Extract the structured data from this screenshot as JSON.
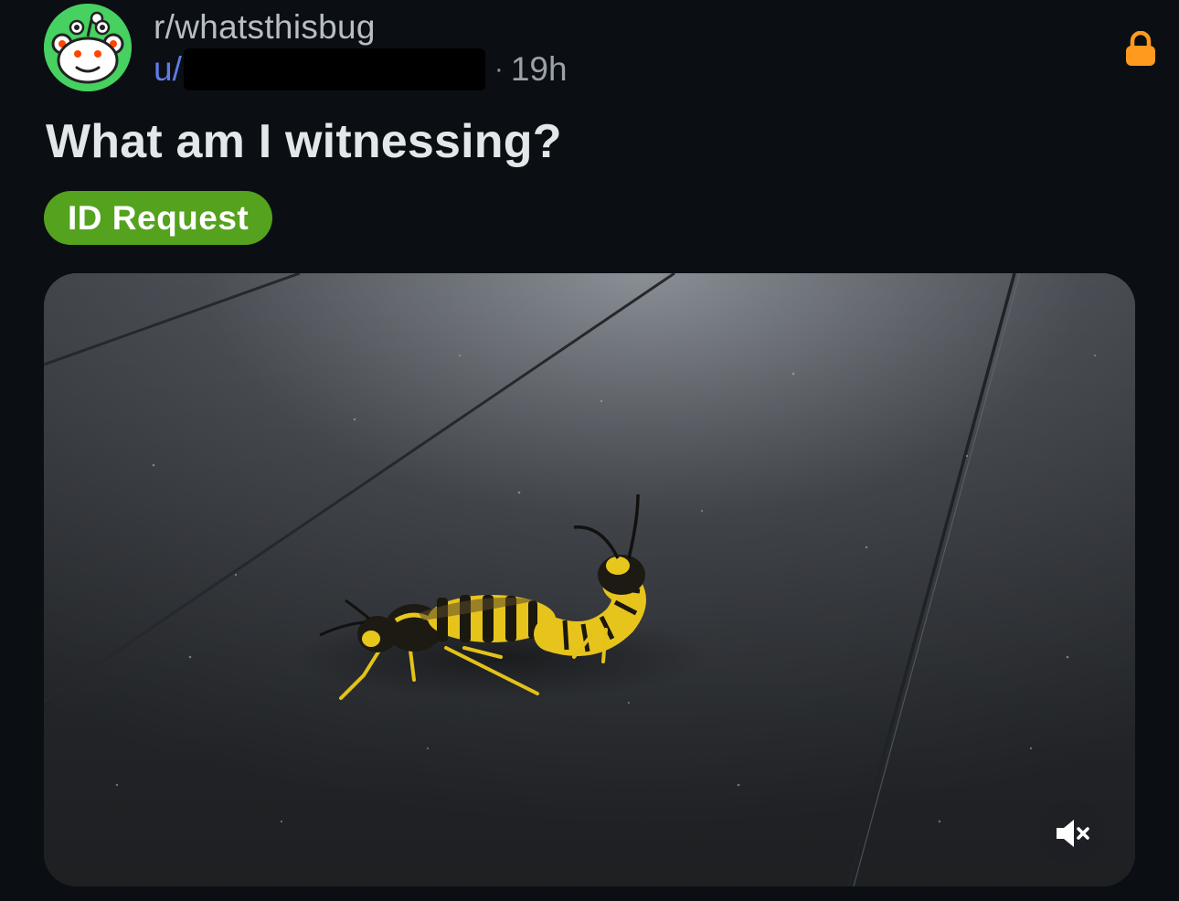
{
  "post": {
    "community": "r/whatsthisbug",
    "author_prefix": "u/",
    "separator": "·",
    "age": "19h",
    "title": "What am I witnessing?",
    "flair": "ID Request",
    "locked": true
  },
  "icons": {
    "avatar": "community-avatar-icon",
    "lock": "lock-icon",
    "mute": "volume-muted-icon"
  },
  "colors": {
    "background": "#0b0f13",
    "flair": "#54a21e",
    "lock": "#ff9a1f",
    "author_link": "#5f7ce6",
    "avatar": "#46d160"
  },
  "media": {
    "type": "video",
    "muted": true
  }
}
